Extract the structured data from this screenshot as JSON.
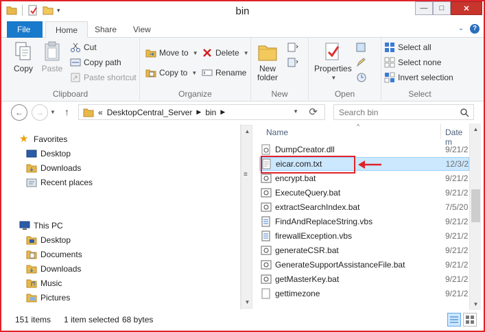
{
  "window": {
    "title": "bin"
  },
  "tabs": {
    "file": "File",
    "home": "Home",
    "share": "Share",
    "view": "View"
  },
  "ribbon": {
    "clipboard": {
      "label": "Clipboard",
      "copy": "Copy",
      "paste": "Paste",
      "cut": "Cut",
      "copy_path": "Copy path",
      "paste_shortcut": "Paste shortcut"
    },
    "organize": {
      "label": "Organize",
      "move_to": "Move to",
      "copy_to": "Copy to",
      "delete": "Delete",
      "rename": "Rename"
    },
    "new": {
      "label": "New",
      "new_folder_line1": "New",
      "new_folder_line2": "folder"
    },
    "open": {
      "label": "Open",
      "properties": "Properties"
    },
    "select": {
      "label": "Select",
      "select_all": "Select all",
      "select_none": "Select none",
      "invert_selection": "Invert selection"
    }
  },
  "address": {
    "prefix": "«",
    "crumb1": "DesktopCentral_Server",
    "crumb2": "bin"
  },
  "search": {
    "placeholder": "Search bin"
  },
  "navpane": {
    "favorites": "Favorites",
    "fav_items": [
      "Desktop",
      "Downloads",
      "Recent places"
    ],
    "thispc": "This PC",
    "pc_items": [
      "Desktop",
      "Documents",
      "Downloads",
      "Music",
      "Pictures"
    ]
  },
  "columns": {
    "name": "Name",
    "date": "Date m"
  },
  "files": [
    {
      "name": "DumpCreator.dll",
      "date": "9/21/2",
      "icon": "dll-icon"
    },
    {
      "name": "eicar.com.txt",
      "date": "12/3/2",
      "icon": "text-file-icon"
    },
    {
      "name": "encrypt.bat",
      "date": "9/21/2",
      "icon": "bat-icon"
    },
    {
      "name": "ExecuteQuery.bat",
      "date": "9/21/2",
      "icon": "bat-icon"
    },
    {
      "name": "extractSearchIndex.bat",
      "date": "7/5/20",
      "icon": "bat-icon"
    },
    {
      "name": "FindAndReplaceString.vbs",
      "date": "9/21/2",
      "icon": "vbs-icon"
    },
    {
      "name": "firewallException.vbs",
      "date": "9/21/2",
      "icon": "vbs-icon"
    },
    {
      "name": "generateCSR.bat",
      "date": "9/21/2",
      "icon": "bat-icon"
    },
    {
      "name": "GenerateSupportAssistanceFile.bat",
      "date": "9/21/2",
      "icon": "bat-icon"
    },
    {
      "name": "getMasterKey.bat",
      "date": "9/21/2",
      "icon": "bat-icon"
    },
    {
      "name": "gettimezone",
      "date": "9/21/2",
      "icon": "file-icon"
    }
  ],
  "status": {
    "count": "151 items",
    "selected": "1 item selected",
    "size": "68 bytes"
  },
  "colors": {
    "accent": "#1979ca",
    "selection": "#cce8ff",
    "annotation": "#e0222a"
  }
}
